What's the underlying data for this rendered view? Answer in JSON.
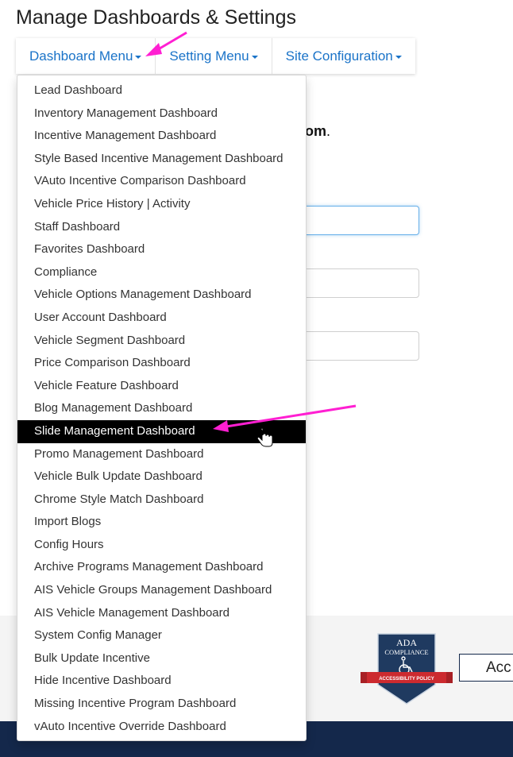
{
  "page": {
    "title": "Manage Dashboards & Settings"
  },
  "nav": {
    "tabs": [
      {
        "label": "Dashboard Menu"
      },
      {
        "label": "Setting Menu"
      },
      {
        "label": "Site Configuration"
      }
    ]
  },
  "background": {
    "partial_text": "om",
    "partial_punct": "."
  },
  "dropdown": {
    "selected": "Slide Management Dashboard",
    "items": [
      "Lead Dashboard",
      "Inventory Management Dashboard",
      "Incentive Management Dashboard",
      "Style Based Incentive Management Dashboard",
      "VAuto Incentive Comparison Dashboard",
      "Vehicle Price History | Activity",
      "Staff Dashboard",
      "Favorites Dashboard",
      "Compliance",
      "Vehicle Options Management Dashboard",
      "User Account Dashboard",
      "Vehicle Segment Dashboard",
      "Price Comparison Dashboard",
      "Vehicle Feature Dashboard",
      "Blog Management Dashboard",
      "Slide Management Dashboard",
      "Promo Management Dashboard",
      "Vehicle Bulk Update Dashboard",
      "Chrome Style Match Dashboard",
      "Import Blogs",
      "Config Hours",
      "Archive Programs Management Dashboard",
      "AIS Vehicle Groups Management Dashboard",
      "AIS Vehicle Management Dashboard",
      "System Config Manager",
      "Bulk Update Incentive",
      "Hide Incentive Dashboard",
      "Missing Incentive Program Dashboard",
      "vAuto Incentive Override Dashboard"
    ]
  },
  "footer": {
    "badge": {
      "line1": "ADA",
      "line2": "COMPLIANCE",
      "ribbon": "ACCESSIBILITY POLICY"
    },
    "button_label": "Acc"
  },
  "colors": {
    "link": "#1a73c8",
    "annotation_arrow": "#ff1fd2",
    "footer_dark": "#14284b",
    "badge": "#1f3a60",
    "ribbon": "#cc2a2f"
  }
}
